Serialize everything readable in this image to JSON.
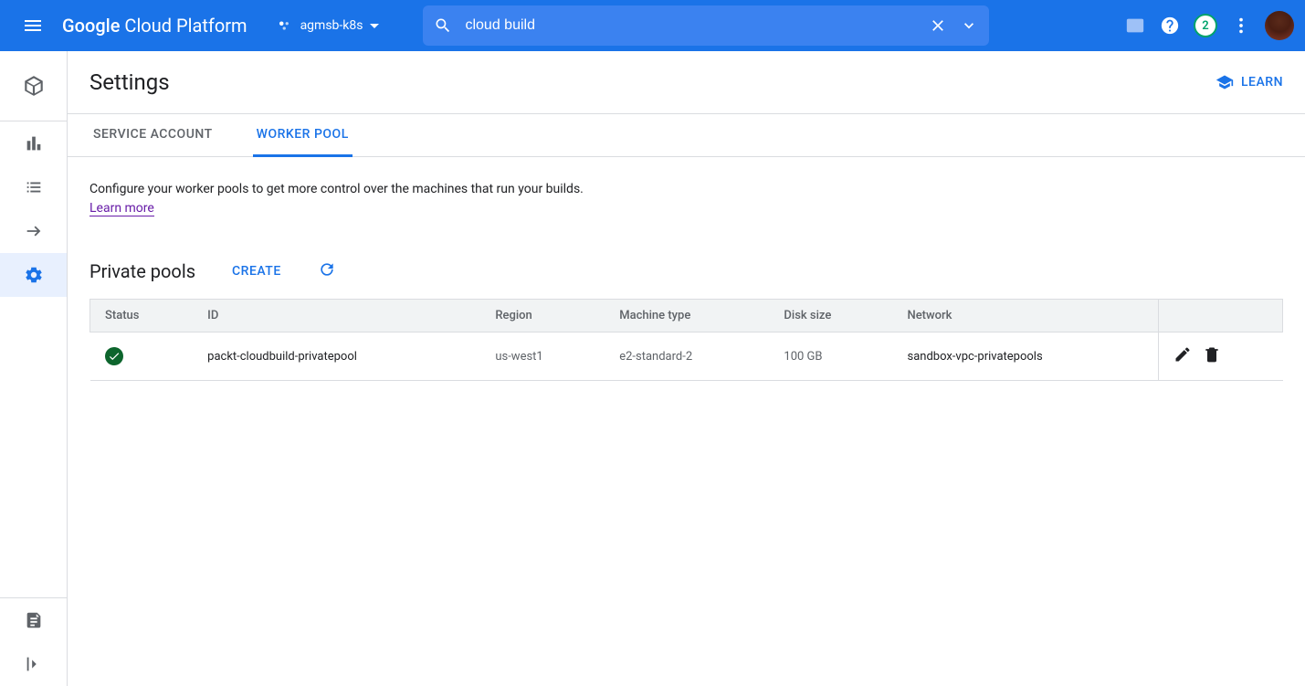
{
  "header": {
    "brand_g": "Google",
    "brand_rest": " Cloud Platform",
    "project_name": "agmsb-k8s",
    "search_value": "cloud build",
    "gift_badge": "2"
  },
  "page": {
    "title": "Settings",
    "learn_label": "LEARN"
  },
  "tabs": {
    "service_account": "SERVICE ACCOUNT",
    "worker_pool": "WORKER POOL"
  },
  "worker_pool": {
    "description": "Configure your worker pools to get more control over the machines that run your builds.",
    "learn_more": "Learn more",
    "section_title": "Private pools",
    "create_label": "CREATE",
    "columns": {
      "status": "Status",
      "id": "ID",
      "region": "Region",
      "machine_type": "Machine type",
      "disk_size": "Disk size",
      "network": "Network"
    },
    "rows": [
      {
        "status": "ok",
        "id": "packt-cloudbuild-privatepool",
        "region": "us-west1",
        "machine_type": "e2-standard-2",
        "disk_size": "100 GB",
        "network": "sandbox-vpc-privatepools"
      }
    ]
  }
}
